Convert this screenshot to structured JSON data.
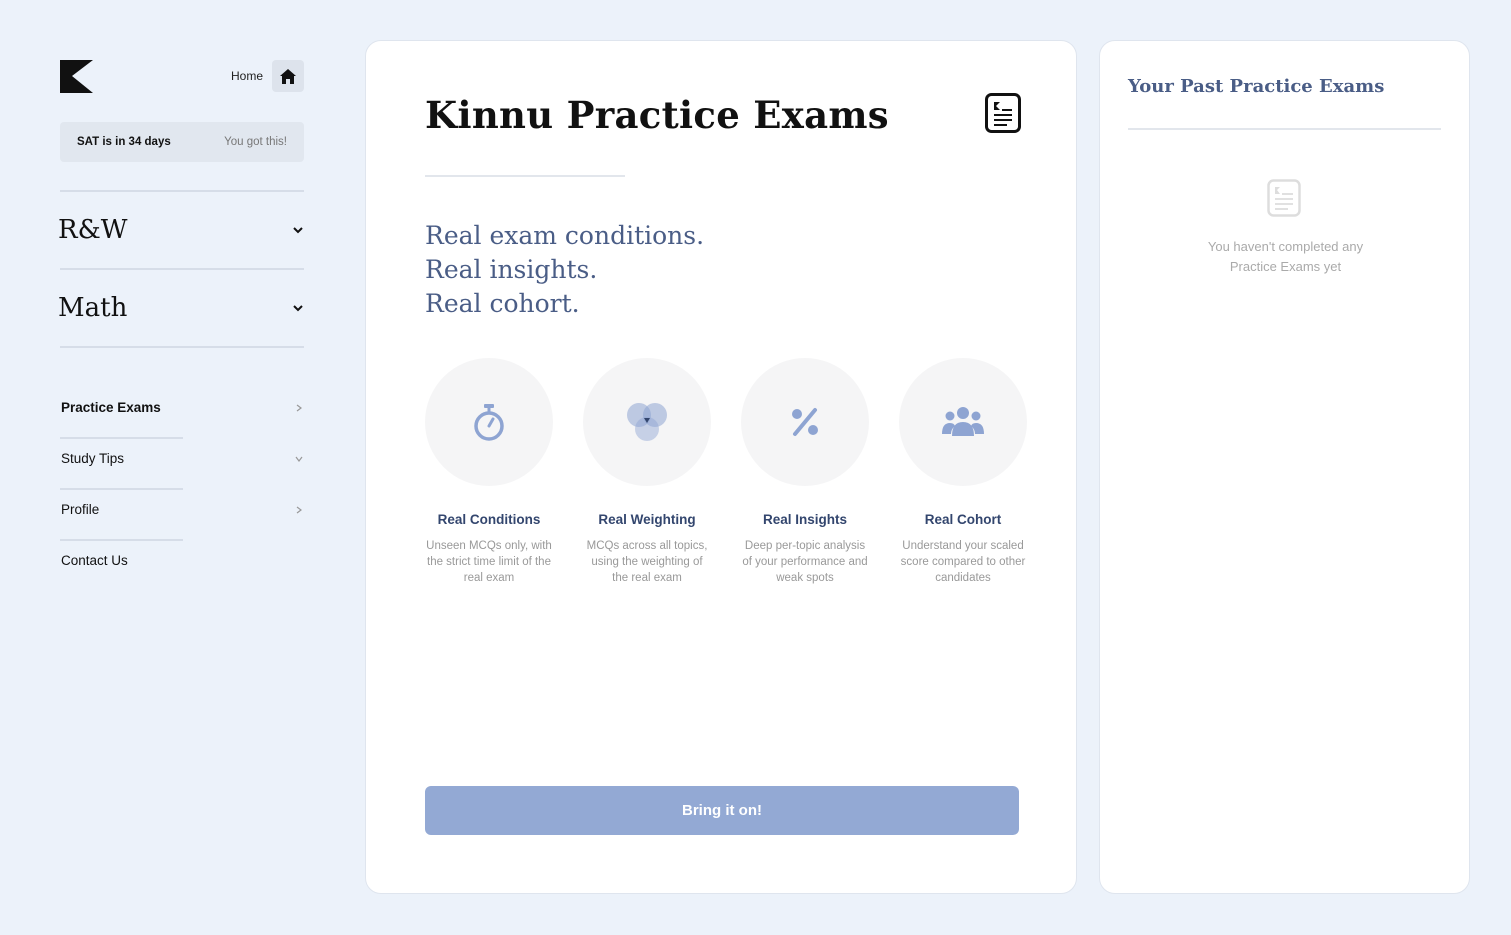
{
  "sidebar": {
    "home_label": "Home",
    "sat_countdown": "SAT is in 34 days",
    "sat_encouragement": "You got this!",
    "sections": [
      {
        "title": "R&W"
      },
      {
        "title": "Math"
      }
    ],
    "nav_items": [
      {
        "label": "Practice Exams"
      },
      {
        "label": "Study Tips"
      },
      {
        "label": "Profile"
      },
      {
        "label": "Contact Us"
      }
    ]
  },
  "main": {
    "title": "Kinnu Practice Exams",
    "tagline": [
      "Real exam conditions.",
      "Real insights.",
      "Real cohort."
    ],
    "features": [
      {
        "name": "Real Conditions",
        "description": "Unseen MCQs only, with the strict time limit of the real exam",
        "icon": "stopwatch-icon"
      },
      {
        "name": "Real Weighting",
        "description": "MCQs across all topics, using the weighting of the real exam",
        "icon": "venn-diagram-icon"
      },
      {
        "name": "Real Insights",
        "description": "Deep per-topic analysis of your performance and weak spots",
        "icon": "percent-icon"
      },
      {
        "name": "Real Cohort",
        "description": "Understand your scaled score compared to other candidates",
        "icon": "group-icon"
      }
    ],
    "cta_label": "Bring it on!"
  },
  "past_exams": {
    "title": "Your Past Practice Exams",
    "empty_message": "You haven't completed any Practice Exams yet"
  },
  "colors": {
    "background": "#ecf2fa",
    "accent_text": "#4a5d86",
    "cta": "#93a9d4",
    "icon": "#8ea4d2"
  }
}
